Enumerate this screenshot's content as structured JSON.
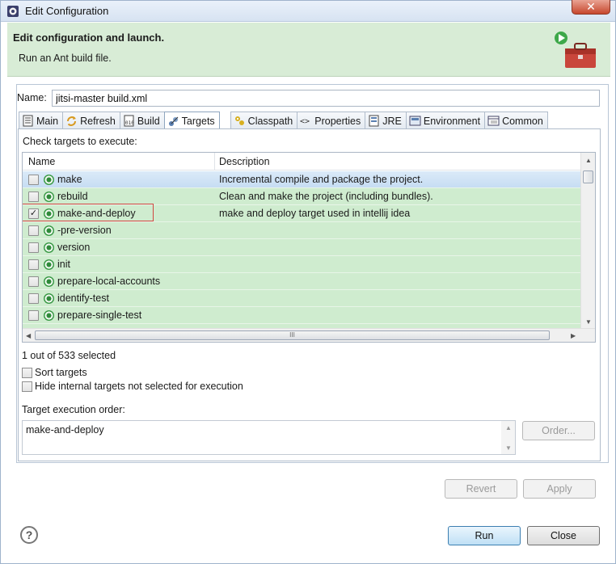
{
  "window": {
    "title": "Edit Configuration",
    "close_glyph": "✕"
  },
  "banner": {
    "title": "Edit configuration and launch.",
    "subtitle": "Run an Ant build file.",
    "icon": "ant-toolbox-icon"
  },
  "name_field": {
    "label": "Name:",
    "value": "jitsi-master build.xml"
  },
  "tabs": [
    {
      "label": "Main",
      "icon": "main-icon"
    },
    {
      "label": "Refresh",
      "icon": "refresh-icon"
    },
    {
      "label": "Build",
      "icon": "build-icon"
    },
    {
      "label": "Targets",
      "icon": "targets-icon"
    },
    {
      "label": "Classpath",
      "icon": "classpath-icon"
    },
    {
      "label": "Properties",
      "icon": "properties-icon"
    },
    {
      "label": "JRE",
      "icon": "jre-icon"
    },
    {
      "label": "Environment",
      "icon": "environment-icon"
    },
    {
      "label": "Common",
      "icon": "common-icon"
    }
  ],
  "active_tab": "Targets",
  "targets": {
    "check_label": "Check targets to execute:",
    "columns": [
      "Name",
      "Description"
    ],
    "rows": [
      {
        "name": "make",
        "description": "Incremental compile and package the project.",
        "checked": false
      },
      {
        "name": "rebuild",
        "description": "Clean and make the project (including bundles).",
        "checked": false
      },
      {
        "name": "make-and-deploy",
        "description": "make and deploy target used in intellij idea",
        "checked": true
      },
      {
        "name": "-pre-version",
        "description": "",
        "checked": false
      },
      {
        "name": "version",
        "description": "",
        "checked": false
      },
      {
        "name": "init",
        "description": "",
        "checked": false
      },
      {
        "name": "prepare-local-accounts",
        "description": "",
        "checked": false
      },
      {
        "name": "identify-test",
        "description": "",
        "checked": false
      },
      {
        "name": "prepare-single-test",
        "description": "",
        "checked": false
      }
    ],
    "hscroll_grip": "III",
    "selected_count": "1 out of 533 selected",
    "sort_label": "Sort targets",
    "hide_internal_label": "Hide internal targets not selected for execution",
    "order_label": "Target execution order:",
    "order_value": "make-and-deploy",
    "order_button": "Order..."
  },
  "buttons": {
    "revert": "Revert",
    "apply": "Apply",
    "run": "Run",
    "close": "Close",
    "help": "?"
  },
  "colors": {
    "banner_bg": "#d8ecd6",
    "row_green": "#cfeccf",
    "highlight_box": "#d0463f"
  }
}
